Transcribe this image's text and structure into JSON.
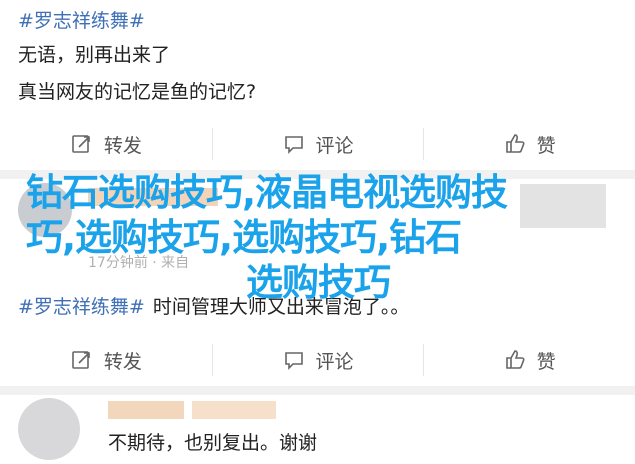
{
  "post": {
    "topic": "#罗志祥练舞#",
    "line1": "无语，别再出来了",
    "line2": "真当网友的记忆是鱼的记忆?"
  },
  "actions": {
    "repost": "转发",
    "comment": "评论",
    "like": "赞"
  },
  "second_post": {
    "time": "17分钟前 · 来自"
  },
  "overlay": {
    "line1": "钻石选购技巧,液晶电视选购技",
    "line2": "巧,选购技巧,选购技巧,钻石",
    "line3": "选购技巧",
    "color": "#1aa2ea"
  },
  "reply": {
    "name": "#罗志祥练舞#",
    "text": "时间管理大师又出来冒泡了。。"
  },
  "bottom_comment": {
    "text": "不期待，也别复出。谢谢"
  },
  "colors": {
    "link": "#3f6fb5",
    "separator": "#f1f1f1"
  }
}
